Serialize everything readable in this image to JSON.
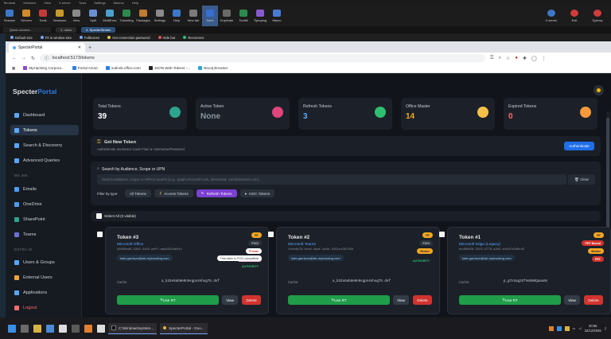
{
  "moba": {
    "menu": [
      "Terminal",
      "Sessions",
      "View",
      "X server",
      "Tools",
      "Settings",
      "Macros",
      "Help"
    ],
    "tools": [
      {
        "label": "Session",
        "color": "#3c78c8"
      },
      {
        "label": "Servers",
        "color": "#d08a2b"
      },
      {
        "label": "Tools",
        "color": "#c23b3b"
      },
      {
        "label": "Sessions",
        "color": "#c79a2a"
      },
      {
        "label": "View",
        "color": "#8a8a8a"
      },
      {
        "label": "Split",
        "color": "#6b8fd0"
      },
      {
        "label": "MultiExec",
        "color": "#4aa1d0"
      },
      {
        "label": "Tunneling",
        "color": "#2d8a4e"
      },
      {
        "label": "Packages",
        "color": "#c07a30"
      },
      {
        "label": "Settings",
        "color": "#8a8a8a"
      },
      {
        "label": "Help",
        "color": "#3c78c8"
      },
      {
        "label": "New tab",
        "color": "#7a7a7a"
      },
      {
        "label": "Save",
        "color": "#3a6fd0"
      },
      {
        "label": "Duplicate",
        "color": "#6a6a6a"
      },
      {
        "label": "Toolkit",
        "color": "#2d8a4e"
      },
      {
        "label": "Tiptoping",
        "color": "#8a5ad0"
      },
      {
        "label": "Macro",
        "color": "#4a7ad0"
      }
    ],
    "right": [
      {
        "label": "X server",
        "color": "#3c78c8"
      },
      {
        "label": "Exit",
        "color": "#d03b3b"
      },
      {
        "label": "Sydney",
        "color": "#d03b3b"
      }
    ],
    "quick_connect": "Quick connect...",
    "tabs": [
      "3. rdesk",
      "4. SpecterStream"
    ]
  },
  "rdp": {
    "items": [
      "Default size",
      "Fit to window size",
      "Fullscreen",
      "Get connection password",
      "Hide bar",
      "Reconnect"
    ]
  },
  "chrome": {
    "tab_title": "SpecterPortal",
    "url": "localhost:5173/tokens",
    "bookmarks": [
      "MyHacking Corpora...",
      "Portal Azure",
      "outlook.office.com",
      "JSON Web Tokens -...",
      "Neo4j Browser"
    ]
  },
  "app": {
    "logo_a": "Specter",
    "logo_b": "Portal",
    "nav_main": [
      {
        "label": "Dashboard",
        "color": "#58a6ff"
      },
      {
        "label": "Tokens",
        "color": "#58a6ff",
        "active": true
      },
      {
        "label": "Search & Discovery",
        "color": "#58a6ff"
      },
      {
        "label": "Advanced Queries",
        "color": "#58a6ff"
      }
    ],
    "section_me": "MS 365",
    "nav_ms": [
      {
        "label": "Emails",
        "color": "#4b9cf5"
      },
      {
        "label": "OneDrive",
        "color": "#4b9cf5"
      },
      {
        "label": "SharePoint",
        "color": "#2ea48f"
      },
      {
        "label": "Teams",
        "color": "#6c6fd6"
      }
    ],
    "section_entra": "ENTRA ID",
    "nav_entra": [
      {
        "label": "Users & Groups",
        "color": "#58a6ff"
      },
      {
        "label": "External Users",
        "color": "#f0a33b"
      },
      {
        "label": "Applications",
        "color": "#58a6ff"
      }
    ],
    "logout": "Logout",
    "stats": [
      {
        "label": "Total Tokens",
        "value": "39",
        "color": "#ffffff",
        "icon": "#2ea48f"
      },
      {
        "label": "Active Token",
        "value": "None",
        "color": "#8b949e",
        "icon": "#e0457b"
      },
      {
        "label": "Refresh Tokens",
        "value": "3",
        "color": "#58a6ff",
        "icon": "#2fbf71"
      },
      {
        "label": "Office Master",
        "value": "14",
        "color": "#f5a623",
        "icon": "#f5c04a"
      },
      {
        "label": "Expired Tokens",
        "value": "0",
        "color": "#ff6b6b",
        "icon": "#f59b3b"
      }
    ],
    "get_token": {
      "title": "Get New Token",
      "subtitle": "Authenticate via Device Code Flow or Username/Password",
      "button": "Authenticate"
    },
    "search": {
      "title": "Search by Audience, Scope or UPN",
      "placeholder": "Search audience, scope or UPN to search (e.g., graph.microsoft.com, directread, user@domain.com)...",
      "clear": "Clear",
      "filter_label": "Filter by type:",
      "filters": [
        "All Tokens",
        "Access Tokens",
        "Refresh Tokens",
        "NGC Tokens"
      ]
    },
    "select_all": "Select All (3 visible)",
    "tokens": [
      {
        "title": "Token #3",
        "app": "Microsoft Office",
        "gid": "d3590ed6-52b3-4102-aeff-aad2292ab01c",
        "user": "kate.garrison@lab-myhacking.com",
        "cache": "Cache:",
        "hash": "a_b32e5ab8e0n9vgpn4nhug75.def",
        "badges": [
          "RT",
          "FOCI",
          "Private",
          "Office Master"
        ],
        "tooltip": "This token is FOCI-compatible",
        "auth": "AUTHORITY",
        "use": "Use RT",
        "view": "View",
        "delete": "Delete"
      },
      {
        "title": "Token #2",
        "app": "Microsoft Teams",
        "gid": "1fec8e78-bce4-4aaf-ab1b-5451cc387264",
        "user": "kate.garrison@lab-myhacking.com",
        "cache": "Cache:",
        "hash": "a_b32e5ab8e0n9vgpn4nhug75.def",
        "badges": [
          "RT",
          "FOCI",
          "Broker"
        ],
        "auth": "AUTHORITY",
        "use": "Use RT",
        "view": "View",
        "delete": "Delete"
      },
      {
        "title": "Token #1",
        "app": "Microsoft Edge (Legacy)",
        "gid": "ecd6b820-32f2-4776-a2b2-e2e37c5b8c45",
        "user": "kate.garrison@lab-myhacking.com",
        "cache": "Cache:",
        "hash": "p_g7n3ag33fnm3m9Qaaa8n",
        "badges": [
          "RT",
          "PRT Bound",
          "Broker",
          "PRT"
        ],
        "use": "Use RT",
        "view": "View",
        "delete": "Delete"
      }
    ]
  },
  "taskbar": {
    "windows": [
      "C:\\Windows\\system...",
      "SpecterPortal - Goo..."
    ],
    "time": "20:55",
    "date": "22/12/2025"
  }
}
